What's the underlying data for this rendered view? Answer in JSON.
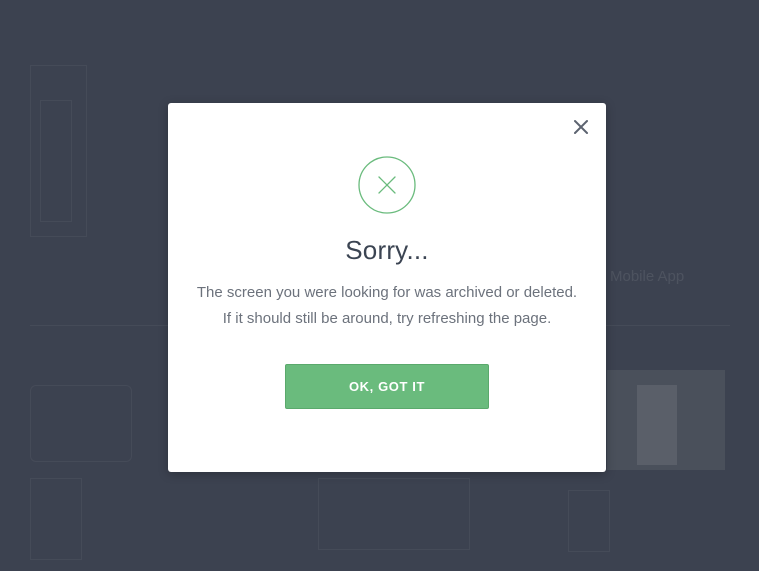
{
  "dialog": {
    "title": "Sorry...",
    "message_line_1": "The screen you were looking for was archived or deleted.",
    "message_line_2": "If it should still be around, try refreshing the page.",
    "ok_button_label": "OK, GOT IT",
    "close_icon": "close-icon",
    "status_icon": "error-x-icon"
  },
  "background": {
    "partial_label": "Mobile App"
  },
  "colors": {
    "overlay": "#3c4250",
    "accent_green": "#6abb7d",
    "title": "#3b4452",
    "message": "#6c727c"
  }
}
